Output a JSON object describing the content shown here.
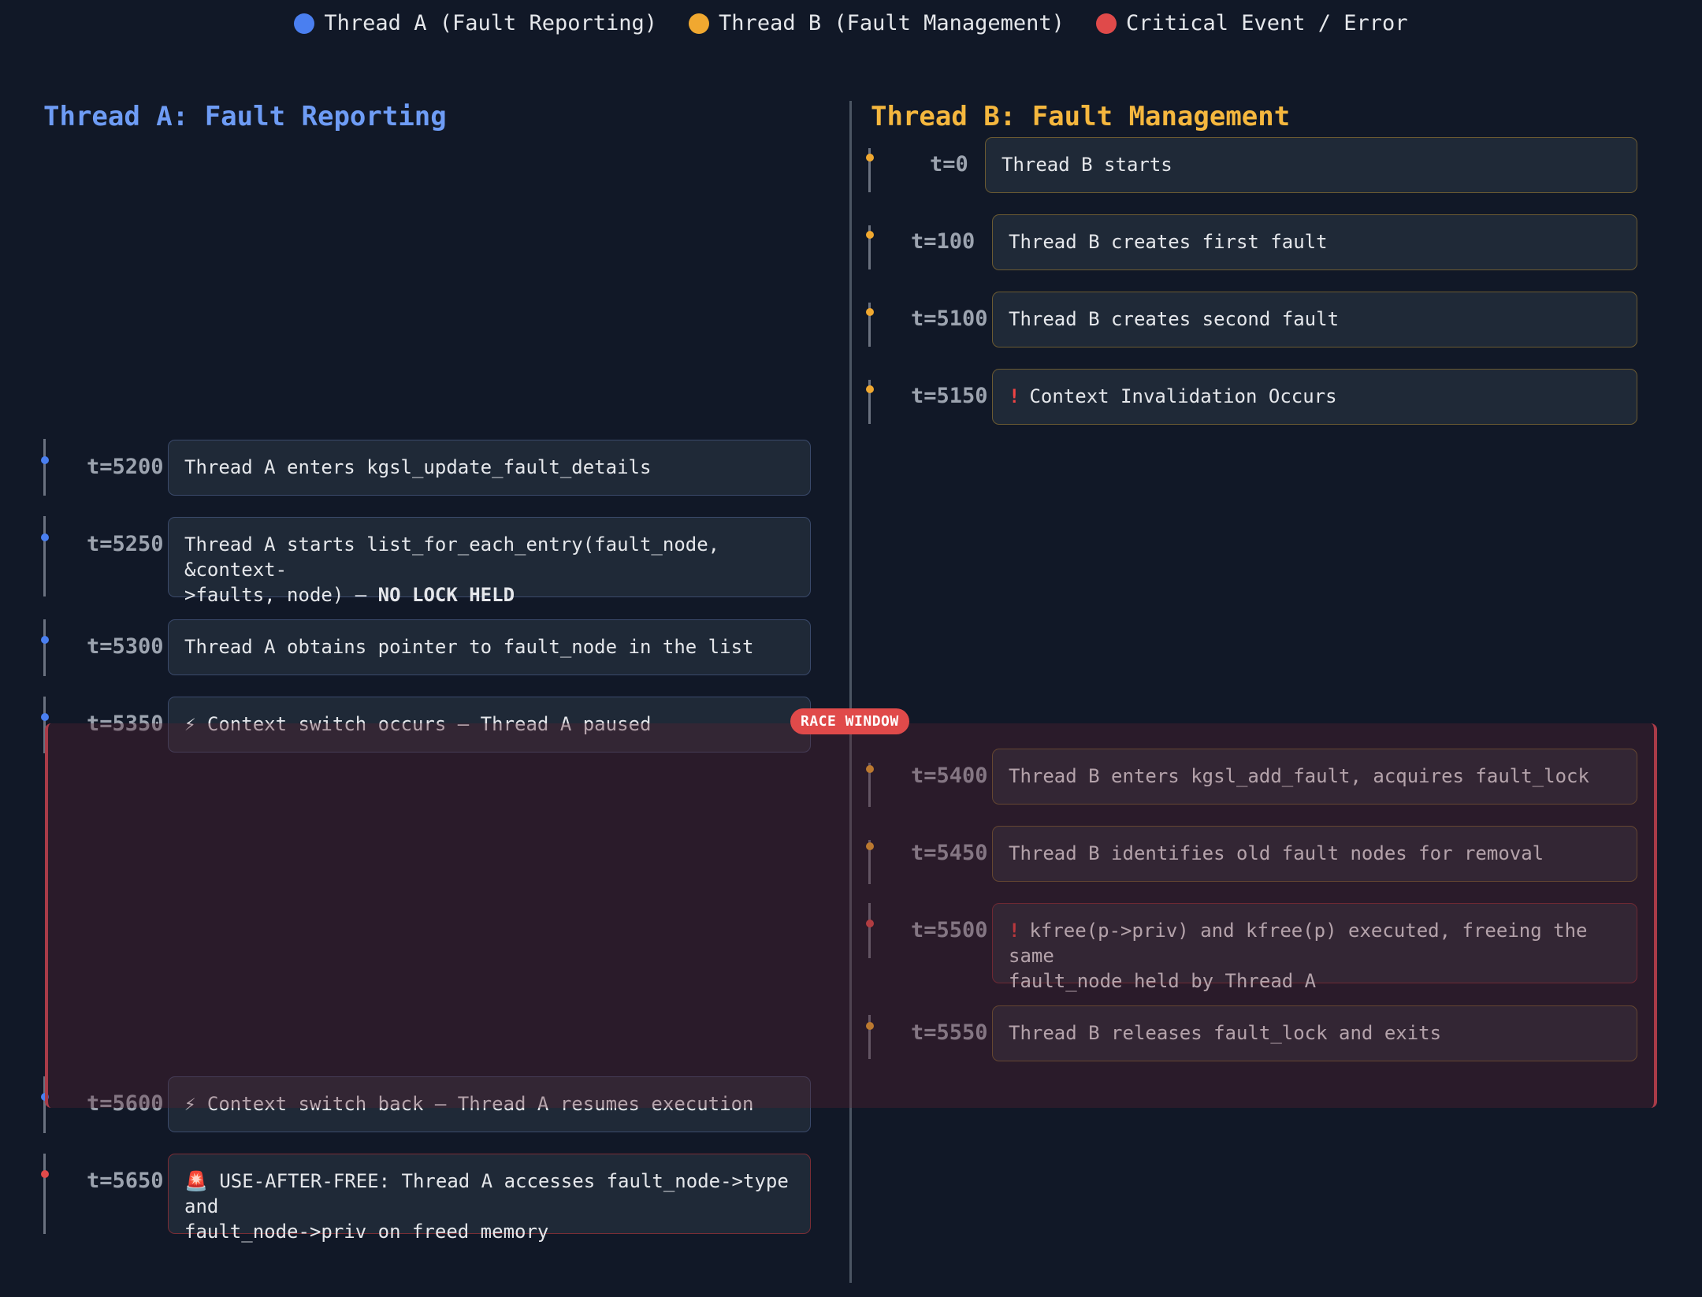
{
  "legend": [
    {
      "label": "Thread A (Fault Reporting)",
      "color": "#4a7ff0"
    },
    {
      "label": "Thread B (Fault Management)",
      "color": "#f0a830"
    },
    {
      "label": "Critical Event / Error",
      "color": "#e04a4a"
    }
  ],
  "columns": {
    "a_title": "Thread A: Fault Reporting",
    "b_title": "Thread B: Fault Management",
    "a_color": "#6e9cf5",
    "b_color": "#f5b73e"
  },
  "race_window_label": "RACE WINDOW",
  "thread_b_events": [
    {
      "time": "t=0",
      "text": "Thread B starts"
    },
    {
      "time": "t=100",
      "text": "Thread B creates first fault"
    },
    {
      "time": "t=5100",
      "text": "Thread B creates second fault"
    },
    {
      "time": "t=5150",
      "text": "Context Invalidation Occurs"
    },
    {
      "time": "t=5400",
      "text": "Thread B enters kgsl_add_fault, acquires fault_lock"
    },
    {
      "time": "t=5450",
      "text": "Thread B identifies old fault nodes for removal"
    },
    {
      "time": "t=5500",
      "text": "kfree(p->priv) and kfree(p) executed, freeing the same",
      "text2": "fault_node held by Thread A"
    },
    {
      "time": "t=5550",
      "text": "Thread B releases fault_lock and exits"
    }
  ],
  "thread_a_events": [
    {
      "time": "t=5200",
      "text": "Thread A enters kgsl_update_fault_details"
    },
    {
      "time": "t=5250",
      "text": "Thread A starts list_for_each_entry(fault_node, &context-",
      "text2": ">faults, node) — ",
      "strong": "NO LOCK HELD"
    },
    {
      "time": "t=5300",
      "text": "Thread A obtains pointer to fault_node in the list"
    },
    {
      "time": "t=5350",
      "text": "⚡ Context switch occurs — Thread A paused"
    },
    {
      "time": "t=5600",
      "text": "⚡ Context switch back — Thread A resumes execution"
    },
    {
      "time": "t=5650",
      "text": "🚨 USE-AFTER-FREE: Thread A accesses fault_node->type and",
      "text2": "fault_node->priv on freed memory"
    }
  ]
}
